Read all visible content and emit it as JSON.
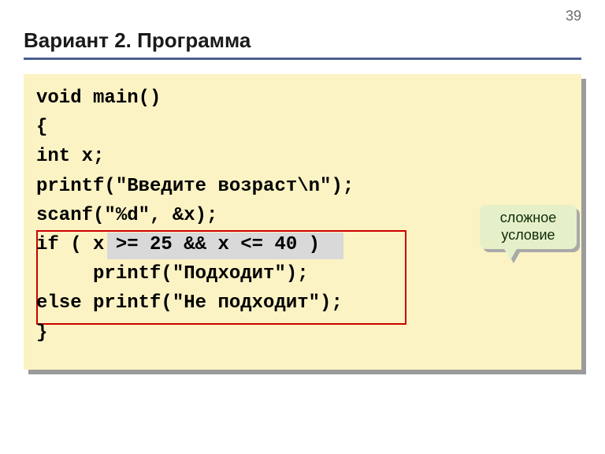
{
  "page_number": "39",
  "title": "Вариант 2. Программа",
  "code": {
    "line1": "void main()",
    "line2": "{",
    "line3": "int x;",
    "line4": "printf(\"Введите возраст\\n\");",
    "line5": "scanf(\"%d\", &x);",
    "line6": "if ( x >= 25 && x <= 40 )",
    "line7": "     printf(\"Подходит\");",
    "line8": "else printf(\"Не подходит\");",
    "line9": "}"
  },
  "callout": {
    "line1": "сложное",
    "line2": "условие"
  }
}
